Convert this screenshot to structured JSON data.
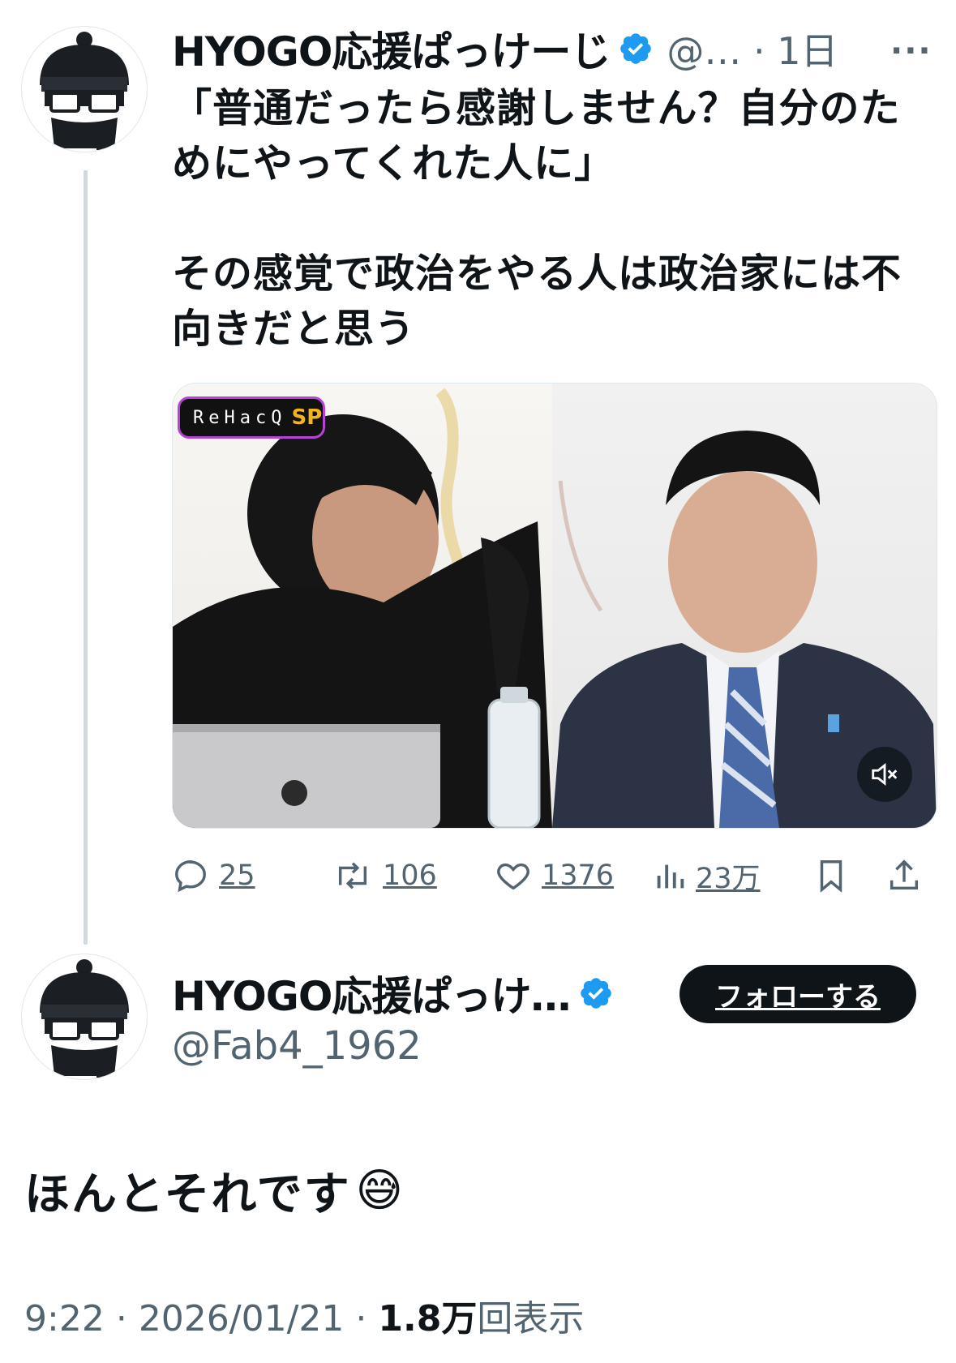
{
  "parent_tweet": {
    "display_name": "HYOGO応援ぱっけーじ",
    "handle_time": "@… · 1日",
    "more": "···",
    "text": "「普通だったら感謝しません？自分のためにやってくれた人に」\n\nその感覚で政治をやる人は政治家には不向きだと思う",
    "media": {
      "badge_text": "ReHacQ",
      "badge_sp": "SP",
      "mute_icon": "speaker-muted-icon"
    },
    "actions": {
      "replies": "25",
      "retweets": "106",
      "likes": "1376",
      "views": "23万"
    }
  },
  "reply_tweet": {
    "display_name": "HYOGO応援ぱっけ…",
    "handle": "@Fab4_1962",
    "follow_label": "フォローする",
    "text": "ほんとそれです",
    "emoji": "😅",
    "time": "9:22",
    "date": "2026/01/21",
    "views_count": "1.8万",
    "views_label": "回表示",
    "sep": "·"
  },
  "colors": {
    "verified": "#1d9bf0",
    "text": "#0f1419",
    "secondary": "#536471",
    "thread_line": "#cfd9de"
  }
}
